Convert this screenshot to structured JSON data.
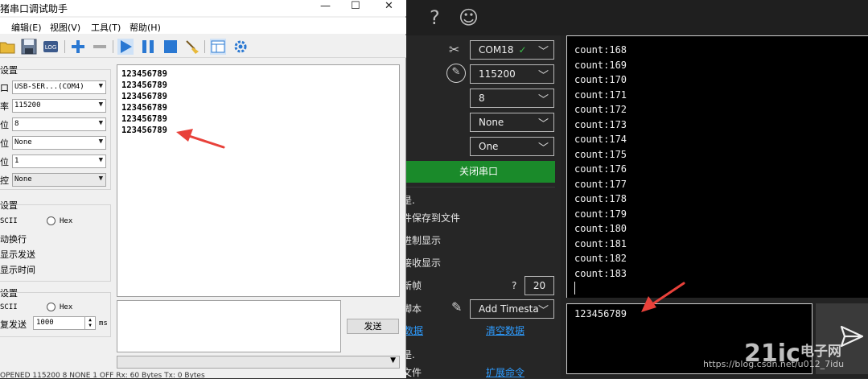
{
  "dark_app": {
    "top_icons": [
      "?",
      "☺"
    ],
    "port_select": {
      "value": "COM18",
      "check": "✓"
    },
    "baud_select": "115200",
    "data_bits_select": "8",
    "parity_select": "None",
    "stop_bits_select": "One",
    "close_port_button": "关闭串口",
    "options": [
      {
        "label": "是."
      },
      {
        "label": "件保存到文件"
      },
      {
        "label": "进制显示"
      },
      {
        "label": "接收显示"
      },
      {
        "label": "新帧"
      },
      {
        "label": "脚本"
      }
    ],
    "frame_question": "?",
    "frame_value": "20",
    "timestamp_select": "Add Timesta",
    "link_send_data": "数据",
    "link_clear_data": "清空数据",
    "bottom_left_text_1": "是.",
    "bottom_left_text_2": "文件",
    "link_extend": "扩展命令",
    "receive_lines": [
      "count:168",
      "count:169",
      "count:170",
      "count:171",
      "count:172",
      "count:173",
      "count:174",
      "count:175",
      "count:176",
      "count:177",
      "count:178",
      "count:179",
      "count:180",
      "count:181",
      "count:182",
      "count:183"
    ],
    "send_text": "123456789"
  },
  "light_app": {
    "title": "猪串口调试助手",
    "menu": [
      "编辑(E)",
      "视图(V)",
      "工具(T)",
      "帮助(H)"
    ],
    "toolbar_log": "LOG",
    "port_settings_title": "设置",
    "rows": [
      {
        "label": "口",
        "value": "USB-SER...(COM4)"
      },
      {
        "label": "率",
        "value": "115200"
      },
      {
        "label": "位",
        "value": "8"
      },
      {
        "label": "位",
        "value": "None"
      },
      {
        "label": "位",
        "value": "1"
      },
      {
        "label": "控",
        "value": "None"
      }
    ],
    "recv_settings_title": "设置",
    "recv_ascii": "SCII",
    "recv_hex": "Hex",
    "recv_options": [
      "动换行",
      "显示发送",
      "显示时间"
    ],
    "send_settings_title": "设置",
    "send_ascii": "SCII",
    "send_hex": "Hex",
    "repeat_label": "复发送",
    "repeat_value": "1000",
    "repeat_unit": "ms",
    "receive_lines": [
      "123456789",
      "123456789",
      "123456789",
      "123456789",
      "123456789",
      "123456789"
    ],
    "send_button": "发送",
    "bottom_combo": "",
    "status_text": "OPENED  115200  8  NONE  1  OFF       Rx: 60 Bytes         Tx: 0 Bytes"
  },
  "watermark": {
    "logo": "21ic",
    "logo_cn": "电子网",
    "url": "https://blog.csdn.net/u012_7idu"
  },
  "colors": {
    "dark_bg": "#232323",
    "green_button": "#1a8a2a",
    "link_blue": "#2e9cff",
    "arrow_red": "#e8413a"
  }
}
